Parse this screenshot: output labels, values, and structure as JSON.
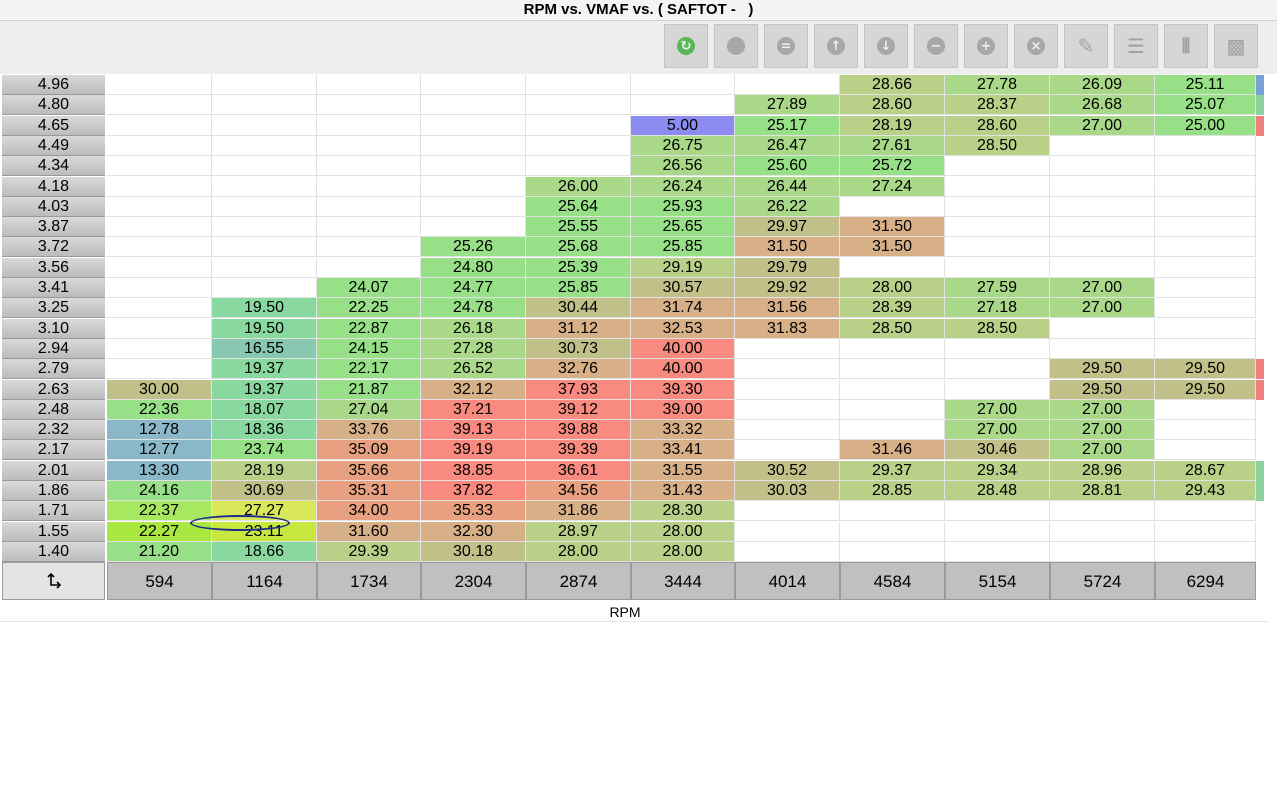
{
  "window": {
    "title": "RPM vs. VMAF vs. ( SAFTOT -   )"
  },
  "toolbar": {
    "buttons": [
      {
        "name": "refresh-button",
        "icon": "green-circle-arrow-icon",
        "color": "#58b858",
        "glyph": "↻"
      },
      {
        "name": "disabled-circle-button",
        "icon": "gray-circle-icon",
        "color": "#a8a8a8",
        "glyph": ""
      },
      {
        "name": "equals-button",
        "icon": "equals-icon",
        "color": "#a8a8a8",
        "glyph": "="
      },
      {
        "name": "increase-button",
        "icon": "arrow-up-icon",
        "color": "#a8a8a8",
        "glyph": "↑"
      },
      {
        "name": "decrease-button",
        "icon": "arrow-down-icon",
        "color": "#a8a8a8",
        "glyph": "↓"
      },
      {
        "name": "subtract-button",
        "icon": "minus-icon",
        "color": "#a8a8a8",
        "glyph": "−"
      },
      {
        "name": "add-button",
        "icon": "plus-icon",
        "color": "#a8a8a8",
        "glyph": "+"
      },
      {
        "name": "multiply-button",
        "icon": "x-icon",
        "color": "#a8a8a8",
        "glyph": "×"
      },
      {
        "name": "edit-button",
        "icon": "pencil-icon",
        "color": "#a8a8a8",
        "glyph": "✎"
      },
      {
        "name": "horizontal-smooth-button",
        "icon": "horizontal-lines-icon",
        "color": "#a8a8a8",
        "glyph": "☰"
      },
      {
        "name": "vertical-smooth-button",
        "icon": "vertical-lines-icon",
        "color": "#a8a8a8",
        "glyph": "⦀"
      },
      {
        "name": "block-button",
        "icon": "block-icon",
        "color": "#a8a8a8",
        "glyph": "▩"
      }
    ]
  },
  "table": {
    "x_axis_label": "RPM",
    "corner_icon": "swap-axes-icon",
    "columns": [
      "594",
      "1164",
      "1734",
      "2304",
      "2874",
      "3444",
      "4014",
      "4584",
      "5154",
      "5724",
      "6294"
    ],
    "rows": [
      {
        "label": "4.96",
        "cells": [
          "",
          "",
          "",
          "",
          "",
          "",
          "",
          "28.66",
          "27.78",
          "26.09",
          "25.11"
        ],
        "edge": "#7aa0d8"
      },
      {
        "label": "4.80",
        "cells": [
          "",
          "",
          "",
          "",
          "",
          "",
          "27.89",
          "28.60",
          "28.37",
          "26.68",
          "25.07"
        ],
        "edge": "#8fd0a0"
      },
      {
        "label": "4.65",
        "cells": [
          "",
          "",
          "",
          "",
          "",
          "5.00",
          "25.17",
          "28.19",
          "28.60",
          "27.00",
          "25.00"
        ],
        "edge": "#f08080"
      },
      {
        "label": "4.49",
        "cells": [
          "",
          "",
          "",
          "",
          "",
          "26.75",
          "26.47",
          "27.61",
          "28.50",
          "",
          ""
        ],
        "edge": ""
      },
      {
        "label": "4.34",
        "cells": [
          "",
          "",
          "",
          "",
          "",
          "26.56",
          "25.60",
          "25.72",
          "",
          "",
          ""
        ],
        "edge": ""
      },
      {
        "label": "4.18",
        "cells": [
          "",
          "",
          "",
          "",
          "26.00",
          "26.24",
          "26.44",
          "27.24",
          "",
          "",
          ""
        ],
        "edge": ""
      },
      {
        "label": "4.03",
        "cells": [
          "",
          "",
          "",
          "",
          "25.64",
          "25.93",
          "26.22",
          "",
          "",
          "",
          ""
        ],
        "edge": ""
      },
      {
        "label": "3.87",
        "cells": [
          "",
          "",
          "",
          "",
          "25.55",
          "25.65",
          "29.97",
          "31.50",
          "",
          "",
          ""
        ],
        "edge": ""
      },
      {
        "label": "3.72",
        "cells": [
          "",
          "",
          "",
          "25.26",
          "25.68",
          "25.85",
          "31.50",
          "31.50",
          "",
          "",
          ""
        ],
        "edge": ""
      },
      {
        "label": "3.56",
        "cells": [
          "",
          "",
          "",
          "24.80",
          "25.39",
          "29.19",
          "29.79",
          "",
          "",
          "",
          ""
        ],
        "edge": ""
      },
      {
        "label": "3.41",
        "cells": [
          "",
          "",
          "24.07",
          "24.77",
          "25.85",
          "30.57",
          "29.92",
          "28.00",
          "27.59",
          "27.00",
          ""
        ],
        "edge": ""
      },
      {
        "label": "3.25",
        "cells": [
          "",
          "19.50",
          "22.25",
          "24.78",
          "30.44",
          "31.74",
          "31.56",
          "28.39",
          "27.18",
          "27.00",
          ""
        ],
        "edge": ""
      },
      {
        "label": "3.10",
        "cells": [
          "",
          "19.50",
          "22.87",
          "26.18",
          "31.12",
          "32.53",
          "31.83",
          "28.50",
          "28.50",
          "",
          ""
        ],
        "edge": ""
      },
      {
        "label": "2.94",
        "cells": [
          "",
          "16.55",
          "24.15",
          "27.28",
          "30.73",
          "40.00",
          "",
          "",
          "",
          "",
          ""
        ],
        "edge": ""
      },
      {
        "label": "2.79",
        "cells": [
          "",
          "19.37",
          "22.17",
          "26.52",
          "32.76",
          "40.00",
          "",
          "",
          "",
          "29.50",
          "29.50"
        ],
        "edge": "#f08080"
      },
      {
        "label": "2.63",
        "cells": [
          "30.00",
          "19.37",
          "21.87",
          "32.12",
          "37.93",
          "39.30",
          "",
          "",
          "",
          "29.50",
          "29.50"
        ],
        "edge": "#f08080"
      },
      {
        "label": "2.48",
        "cells": [
          "22.36",
          "18.07",
          "27.04",
          "37.21",
          "39.12",
          "39.00",
          "",
          "",
          "27.00",
          "27.00",
          ""
        ],
        "edge": ""
      },
      {
        "label": "2.32",
        "cells": [
          "12.78",
          "18.36",
          "33.76",
          "39.13",
          "39.88",
          "33.32",
          "",
          "",
          "27.00",
          "27.00",
          ""
        ],
        "edge": ""
      },
      {
        "label": "2.17",
        "cells": [
          "12.77",
          "23.74",
          "35.09",
          "39.19",
          "39.39",
          "33.41",
          "",
          "31.46",
          "30.46",
          "27.00",
          ""
        ],
        "edge": ""
      },
      {
        "label": "2.01",
        "cells": [
          "13.30",
          "28.19",
          "35.66",
          "38.85",
          "36.61",
          "31.55",
          "30.52",
          "29.37",
          "29.34",
          "28.96",
          "28.67"
        ],
        "edge": "#8fd0a0"
      },
      {
        "label": "1.86",
        "cells": [
          "24.16",
          "30.69",
          "35.31",
          "37.82",
          "34.56",
          "31.43",
          "30.03",
          "28.85",
          "28.48",
          "28.81",
          "29.43"
        ],
        "edge": "#8fd0a0"
      },
      {
        "label": "1.71",
        "cells": [
          "22.37",
          "27.27",
          "34.00",
          "35.33",
          "31.86",
          "28.30",
          "",
          "",
          "",
          "",
          ""
        ],
        "edge": ""
      },
      {
        "label": "1.55",
        "cells": [
          "22.27",
          "23.11",
          "31.60",
          "32.30",
          "28.97",
          "28.00",
          "",
          "",
          "",
          "",
          ""
        ],
        "edge": ""
      },
      {
        "label": "1.40",
        "cells": [
          "21.20",
          "18.66",
          "29.39",
          "30.18",
          "28.00",
          "28.00",
          "",
          "",
          "",
          "",
          ""
        ],
        "edge": ""
      }
    ],
    "highlight_cells": [
      {
        "row": 21,
        "col": 0,
        "color": "#a8e860"
      },
      {
        "row": 21,
        "col": 1,
        "color": "#d8e858"
      },
      {
        "row": 22,
        "col": 0,
        "color": "#a8e840"
      },
      {
        "row": 22,
        "col": 1,
        "color": "#c8e840"
      }
    ]
  }
}
